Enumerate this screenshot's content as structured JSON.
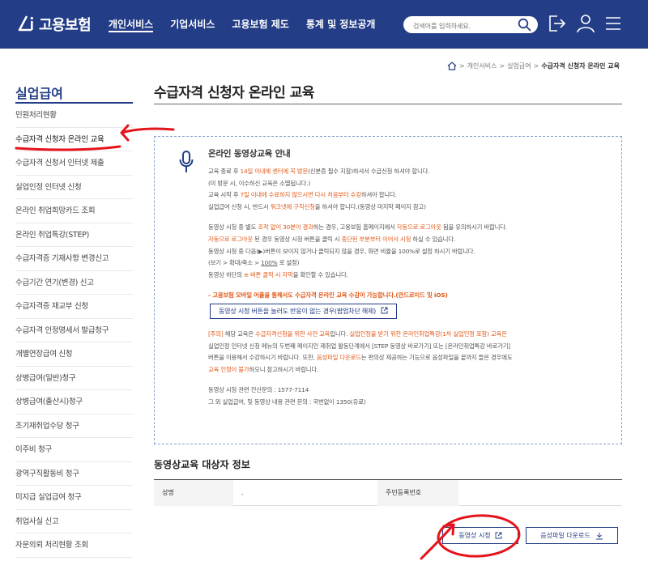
{
  "header": {
    "logo_text": "고용보험",
    "nav": [
      "개인서비스",
      "기업서비스",
      "고용보험 제도",
      "통계 및 정보공개"
    ],
    "search_placeholder": "검색어를 입력하세요."
  },
  "breadcrumb": {
    "items": [
      "개인서비스",
      "실업급여"
    ],
    "current": "수급자격 신청자 온라인 교육"
  },
  "sidebar": {
    "title": "실업급여",
    "items": [
      "민원처리현황",
      "수급자격 신청자 온라인 교육",
      "수급자격 신청서 인터넷 제출",
      "실업인정 인터넷 신청",
      "온라인 취업희망카드 조회",
      "온라인 취업특강(STEP)",
      "수급자격증 기재사항 변경신고",
      "수급기간 연기(변경) 신고",
      "수급자격증 재교부 신청",
      "수급자격 인정명세서 발급청구",
      "개별연장급여 신청",
      "상병급여(일반)청구",
      "상병급여(출산시)청구",
      "조기재취업수당 청구",
      "이주비 청구",
      "광역구직활동비 청구",
      "미지급 실업급여 청구",
      "취업사실 신고",
      "자문의뢰 처리현황 조회"
    ],
    "active_index": 1
  },
  "main": {
    "title": "수급자격 신청자 온라인 교육",
    "notice": {
      "title": "온라인 동영상교육 안내",
      "p1a": "교육 종료 후 ",
      "p1b": "14일 이내에 센터에 꼭 방문",
      "p1c": "(신분증 필수 지참)하셔서 수급신청 하셔야 합니다.",
      "p2": "(미 방문 시, 이수하신 교육은 소멸됩니다.)",
      "p3a": "교육 시작 후 ",
      "p3b": "7일 이내에 수료하지 않으시면 다시 처음부터 수강",
      "p3c": "하셔야 합니다.",
      "p4a": "실업급여 신청 시, 반드시 ",
      "p4b": "워크넷에 구직신청",
      "p4c": "을 하셔야 합니다.(동영상 마지막 페이지 참고)",
      "p5a": "동영상 시청 중 별도 ",
      "p5b": "조작 없이 30분이 경과",
      "p5c": "하는 경우, 고용보험 홈페이지에서 ",
      "p5d": "자동으로 로그아웃",
      "p5e": " 됨을 유의하시기 바랍니다.",
      "p6a": "자동으로 로그아웃",
      "p6b": " 된 경우 동영상 시청 버튼을 클릭 시 ",
      "p6c": "중단된 부분부터 이어서 시청",
      "p6d": " 하실 수 있습니다.",
      "p7": "동영상 시청 중 다음(▶)버튼이 보이지 않거나 클릭되지 않을 경우, 화면 비율을 100%로 설정 하시기 바랍니다.",
      "p8a": "(보기 > 확대/축소 > ",
      "p8b": "100%",
      "p8c": " 로 설정)",
      "p9a": "동영상 하단의 ",
      "p9b": "≡ 버튼 클릭 시 자막",
      "p9c": "을 확인할 수 있습니다.",
      "mobile": "- 고용보험 모바일 어플을 통해서도 수급자격 온라인 교육 수강이 가능합니다.(안드로이드 및 iOS)",
      "popup_button": "동영상 시청 버튼을 눌러도 반응이 없는 경우(팝업차단 해제)",
      "c1a": "[주의]",
      "c1b": " 해당 교육은 ",
      "c1c": "수급자격신청을 위한 사전 교육",
      "c1d": "입니다. ",
      "c1e": "실업인정을 받기 위한 온라인취업특강(1차 실업인정 포함) 교육은",
      "c2": "실업인정 인터넷 신청 메뉴의 두번째 페이지인 재취업 활동단계에서 [STEP 동영상 바로가기] 또는 [온라인취업특강 바로가기]",
      "c3a": "버튼을 이용해서 수강하시기 바랍니다. 또한, ",
      "c3b": "음성파일 다운로드",
      "c3c": "는 편의상 제공하는 기능으로 음성파일을 끝까지 들은 경우에도",
      "c4a": "교육 인정이 불가",
      "c4b": "하오니 참고하시기 바랍니다.",
      "contact1": "동영상 시청 관련 전산문의 : 1577-7114",
      "contact2": "그 외 실업급여, 및 동영상 내용 관련 문의 : 국번없이 1350(유료)"
    },
    "section_title": "동영상교육 대상자 정보",
    "table": {
      "name_label": "성명",
      "name_value": ".",
      "rrn_label": "주민등록번호",
      "rrn_value": ""
    },
    "buttons": {
      "watch": "동영상 시청",
      "download": "음성파일 다운로드"
    }
  },
  "colors": {
    "header_bg": "#233d86",
    "accent_orange": "#e05a1a",
    "annotation_red": "#e5141c"
  }
}
